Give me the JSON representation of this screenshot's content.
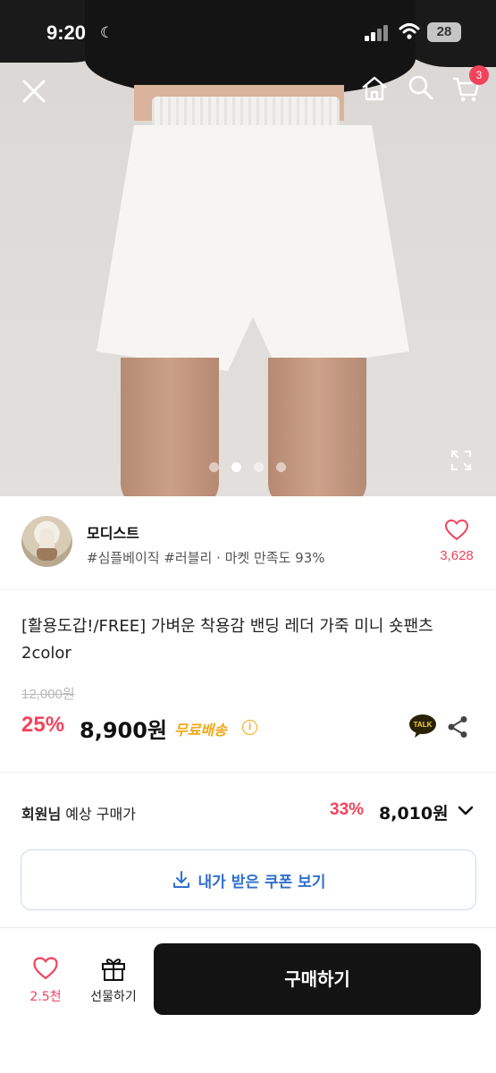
{
  "status_bar": {
    "time": "9:20",
    "battery": "28"
  },
  "header": {
    "cart_count": "3"
  },
  "gallery": {
    "image_count": 4,
    "active_index": 1
  },
  "seller": {
    "name": "모디스트",
    "tags": "#심플베이직 #러블리 · 마켓 만족도 93%",
    "likes": "3,628"
  },
  "product": {
    "title": "[활용도갑!/FREE] 가벼운 착용감 밴딩 레더 가죽 미니 숏팬츠 2color",
    "original_price": "12,000원",
    "discount": "25%",
    "price": "8,900원",
    "shipping": "무료배송",
    "info_glyph": "i"
  },
  "member": {
    "label_bold": "회원님",
    "label_rest": " 예상 구매가",
    "discount": "33%",
    "price": "8,010원"
  },
  "coupon": {
    "label": "내가 받은 쿠폰 보기"
  },
  "bottom_bar": {
    "wish_count": "2.5천",
    "gift_label": "선물하기",
    "buy_label": "구매하기"
  },
  "colors": {
    "accent_red": "#f2435b",
    "shipping_yellow": "#f0a816",
    "coupon_blue": "#2f6fce",
    "buy_button": "#131313"
  },
  "icons": [
    "close-icon",
    "home-icon",
    "search-icon",
    "cart-icon",
    "expand-icon",
    "heart-icon",
    "kakao-talk-icon",
    "share-icon",
    "chevron-down-icon",
    "download-icon",
    "gift-icon"
  ]
}
